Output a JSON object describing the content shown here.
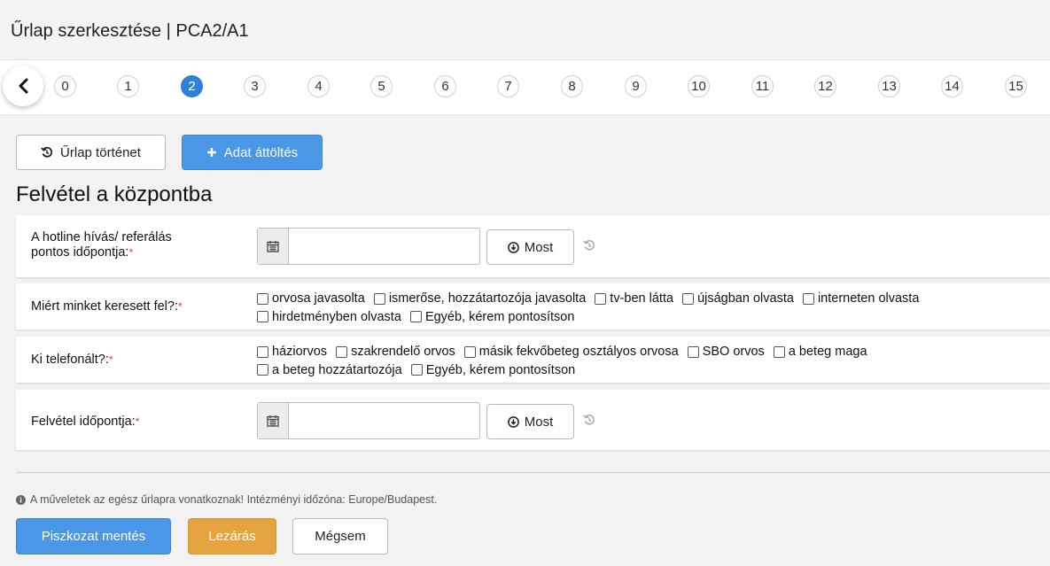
{
  "window": {
    "title": "Űrlap szerkesztése | PCA2/A1"
  },
  "steps": [
    "0",
    "1",
    "2",
    "3",
    "4",
    "5",
    "6",
    "7",
    "8",
    "9",
    "10",
    "11",
    "12",
    "13",
    "14",
    "15"
  ],
  "active_step": "2",
  "toolbar": {
    "history_label": "Űrlap történet",
    "transfer_label": "Adat áttöltés"
  },
  "section": {
    "title": "Felvétel a központba"
  },
  "fields": {
    "hotline": {
      "label_line1": "A hotline hívás/ referálás",
      "label_line2": "pontos időpontja:",
      "value": "",
      "now_label": "Most"
    },
    "why": {
      "label": "Miért minket keresett fel?:",
      "options": [
        "orvosa javasolta",
        "ismerőse, hozzátartozója javasolta",
        "tv-ben látta",
        "újságban olvasta",
        "interneten olvasta",
        "hirdetményben olvasta",
        "Egyéb, kérem pontosítson"
      ]
    },
    "who": {
      "label": "Ki telefonált?:",
      "options": [
        "háziorvos",
        "szakrendelő orvos",
        "másik fekvőbeteg osztályos orvosa",
        "SBO orvos",
        "a beteg maga",
        "a beteg hozzátartozója",
        "Egyéb, kérem pontosítson"
      ]
    },
    "admission": {
      "label": "Felvétel időpontja:",
      "value": "",
      "now_label": "Most"
    },
    "required_mark": "*"
  },
  "footer": {
    "info": "A műveletek az egész űrlapra vonatkoznak! Intézményi időzóna: Europe/Budapest.",
    "draft_label": "Piszkozat mentés",
    "close_label": "Lezárás",
    "cancel_label": "Mégsem"
  },
  "colors": {
    "primary": "#4a97e8",
    "warning": "#e6a440",
    "active_step": "#2f80d8",
    "required": "#e23b3b"
  }
}
